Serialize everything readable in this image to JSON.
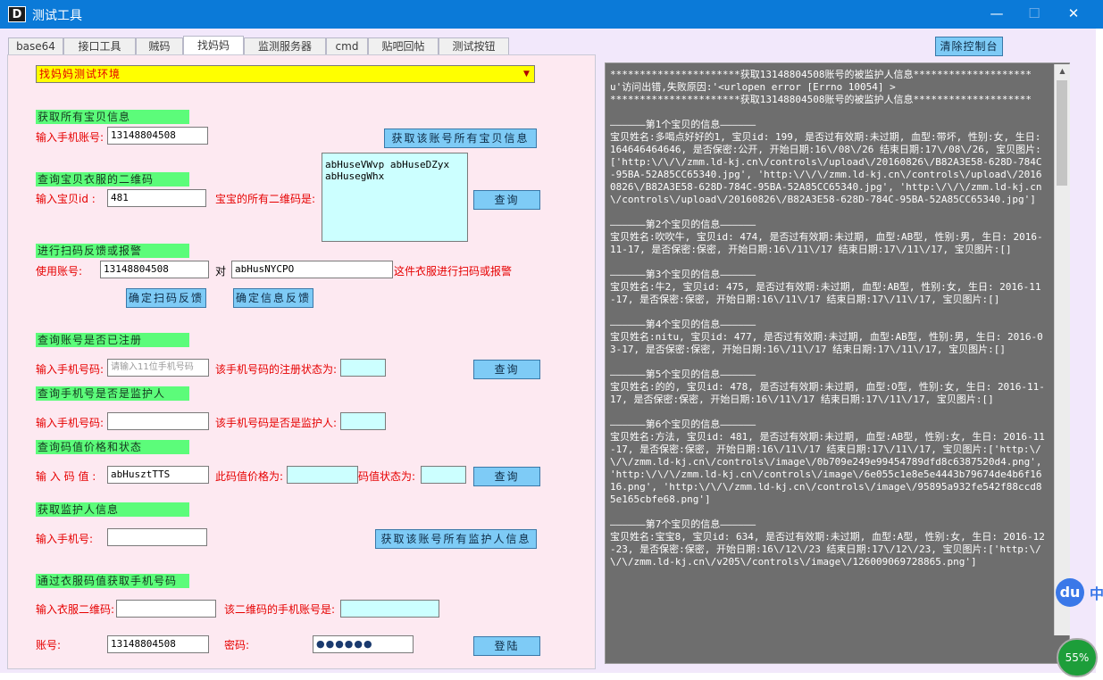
{
  "window": {
    "icon_letter": "D",
    "title": "测试工具",
    "minimize": "—",
    "maximize": "☐",
    "close": "✕"
  },
  "tabs": [
    {
      "label": "base64"
    },
    {
      "label": "接口工具"
    },
    {
      "label": "贼码"
    },
    {
      "label": "找妈妈",
      "active": true
    },
    {
      "label": "监测服务器"
    },
    {
      "label": "cmd"
    },
    {
      "label": "贴吧回帖"
    },
    {
      "label": "测试按钮"
    }
  ],
  "clear_console_button": "清除控制台",
  "env_select": {
    "value": "找妈妈测试环境"
  },
  "section_babies": {
    "header": "获取所有宝贝信息",
    "phone_label": "输入手机账号:",
    "phone_value": "13148804508",
    "button": "获取该账号所有宝贝信息"
  },
  "section_qr": {
    "header": "查询宝贝衣服的二维码",
    "baby_id_label": "输入宝贝id :",
    "baby_id_value": "481",
    "result_label": "宝宝的所有二维码是:",
    "result_lines": [
      "abHuseVWvp  abHuseDZyx",
      "abHusegWhx"
    ],
    "button": "查询"
  },
  "section_report": {
    "header": "进行扫码反馈或报警",
    "account_label": "使用账号:",
    "account_value": "13148804508",
    "to_label": "对",
    "code_value": "abHusNYCPO",
    "suffix_label": "这件衣服进行扫码或报警",
    "button_scan": "确定扫码反馈",
    "button_info": "确定信息反馈"
  },
  "section_registered": {
    "header": "查询账号是否已注册",
    "phone_label": "输入手机号码:",
    "phone_placeholder": "请输入11位手机号码",
    "status_label": "该手机号码的注册状态为:",
    "button": "查询"
  },
  "section_guardian": {
    "header": "查询手机号是否是监护人",
    "phone_label": "输入手机号码:",
    "status_label": "该手机号码是否是监护人:"
  },
  "section_price": {
    "header": "查询码值价格和状态",
    "code_label": "输 入 码 值 :",
    "code_value": "abHusztTTS",
    "price_label": "此码值价格为:",
    "status_label": "码值状态为:",
    "button": "查询"
  },
  "section_get_guardian": {
    "header": "获取监护人信息",
    "phone_label": "输入手机号:",
    "button": "获取该账号所有监护人信息"
  },
  "section_qr_phone": {
    "header": "通过衣服码值获取手机号码",
    "qr_label": "输入衣服二维码:",
    "result_label": "该二维码的手机账号是:"
  },
  "login": {
    "account_label": "账号:",
    "account_value": "13148804508",
    "password_label": "密码:",
    "password_value": "●●●●●●",
    "button": "登陆"
  },
  "console_lines": [
    "**********************获取13148804508账号的被监护人信息********************",
    "u'访问出错,失败原因:'<urlopen error [Errno 10054] >",
    "**********************获取13148804508账号的被监护人信息********************",
    "",
    "——————第1个宝贝的信息——————",
    "宝贝姓名:多喝点好好的1, 宝贝id: 199, 是否过有效期:未过期, 血型:带坏, 性别:女, 生日: 164646464646, 是否保密:公开, 开始日期:16\\/08\\/26 结束日期:17\\/08\\/26, 宝贝图片:['http:\\/\\/\\/zmm.ld-kj.cn\\/controls\\/upload\\/20160826\\/B82A3E58-628D-784C-95BA-52A85CC65340.jpg', 'http:\\/\\/\\/zmm.ld-kj.cn\\/controls\\/upload\\/20160826\\/B82A3E58-628D-784C-95BA-52A85CC65340.jpg', 'http:\\/\\/\\/zmm.ld-kj.cn\\/controls\\/upload\\/20160826\\/B82A3E58-628D-784C-95BA-52A85CC65340.jpg']",
    "",
    "——————第2个宝贝的信息——————",
    "宝贝姓名:吹吹牛, 宝贝id: 474, 是否过有效期:未过期, 血型:AB型, 性别:男, 生日: 2016-11-17, 是否保密:保密, 开始日期:16\\/11\\/17 结束日期:17\\/11\\/17, 宝贝图片:[]",
    "",
    "——————第3个宝贝的信息——————",
    "宝贝姓名:牛2, 宝贝id: 475, 是否过有效期:未过期, 血型:AB型, 性别:女, 生日: 2016-11-17, 是否保密:保密, 开始日期:16\\/11\\/17 结束日期:17\\/11\\/17, 宝贝图片:[]",
    "",
    "——————第4个宝贝的信息——————",
    "宝贝姓名:nitu, 宝贝id: 477, 是否过有效期:未过期, 血型:AB型, 性别:男, 生日: 2016-03-17, 是否保密:保密, 开始日期:16\\/11\\/17 结束日期:17\\/11\\/17, 宝贝图片:[]",
    "",
    "——————第5个宝贝的信息——————",
    "宝贝姓名:的的, 宝贝id: 478, 是否过有效期:未过期, 血型:O型, 性别:女, 生日: 2016-11-17, 是否保密:保密, 开始日期:16\\/11\\/17 结束日期:17\\/11\\/17, 宝贝图片:[]",
    "",
    "——————第6个宝贝的信息——————",
    "宝贝姓名:方法, 宝贝id: 481, 是否过有效期:未过期, 血型:AB型, 性别:女, 生日: 2016-11-17, 是否保密:保密, 开始日期:16\\/11\\/17 结束日期:17\\/11\\/17, 宝贝图片:['http:\\/\\/\\/zmm.ld-kj.cn\\/controls\\/image\\/0b709e249e99454789dfd8c6387520d4.png', 'http:\\/\\/\\/zmm.ld-kj.cn\\/controls\\/image\\/6e055c1e8e5e4443b79674de4b6f1616.png', 'http:\\/\\/\\/zmm.ld-kj.cn\\/controls\\/image\\/95895a932fe542f88ccd85e165cbfe68.png']",
    "",
    "——————第7个宝贝的信息——————",
    "宝贝姓名:宝宝8, 宝贝id: 634, 是否过有效期:未过期, 血型:A型, 性别:女, 生日: 2016-12-23, 是否保密:保密, 开始日期:16\\/12\\/23 结束日期:17\\/12\\/23, 宝贝图片:['http:\\/\\/\\/zmm.ld-kj.cn\\/v205\\/controls\\/image\\/126009069728865.png']"
  ],
  "overlay": {
    "du_label": "du",
    "zh_label": "中",
    "percent": "55%"
  }
}
